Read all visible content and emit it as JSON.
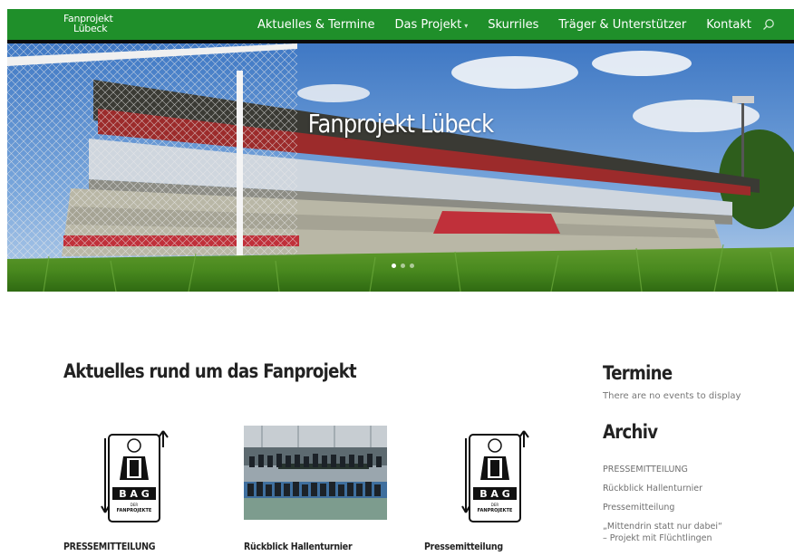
{
  "brand": {
    "logo_line1": "Fanprojekt",
    "logo_line2": "Lübeck",
    "nav_color": "#1f8f2a"
  },
  "nav": {
    "items": [
      {
        "label": "Aktuelles & Termine"
      },
      {
        "label": "Das Projekt"
      },
      {
        "label": "Skurriles"
      },
      {
        "label": "Träger & Unterstützer"
      },
      {
        "label": "Kontakt"
      }
    ],
    "dropdown_icon": "chevron-down-icon",
    "search_icon": "search-icon"
  },
  "hero": {
    "title": "Fanprojekt Lübeck",
    "slides": 3,
    "active_slide": 1
  },
  "main": {
    "section_title": "Aktuelles rund um das Fanprojekt",
    "posts": [
      {
        "title": "PRESSEMITTEILUNG",
        "image": "bag-logo"
      },
      {
        "title": "Rückblick Hallenturnier",
        "image": "team-photo"
      },
      {
        "title": "Pressemitteilung",
        "image": "bag-logo"
      }
    ],
    "bag_logo_text": "B A G",
    "bag_logo_sub1": "DER",
    "bag_logo_sub2": "FANPROJEKTE"
  },
  "sidebar": {
    "termine_title": "Termine",
    "termine_empty": "There are no events to display",
    "archiv_title": "Archiv",
    "archiv_items": [
      "PRESSEMITTEILUNG",
      "Rückblick Hallenturnier",
      "Pressemitteilung",
      "„Mittendrin statt nur dabei“\n– Projekt mit Flüchtlingen"
    ]
  }
}
